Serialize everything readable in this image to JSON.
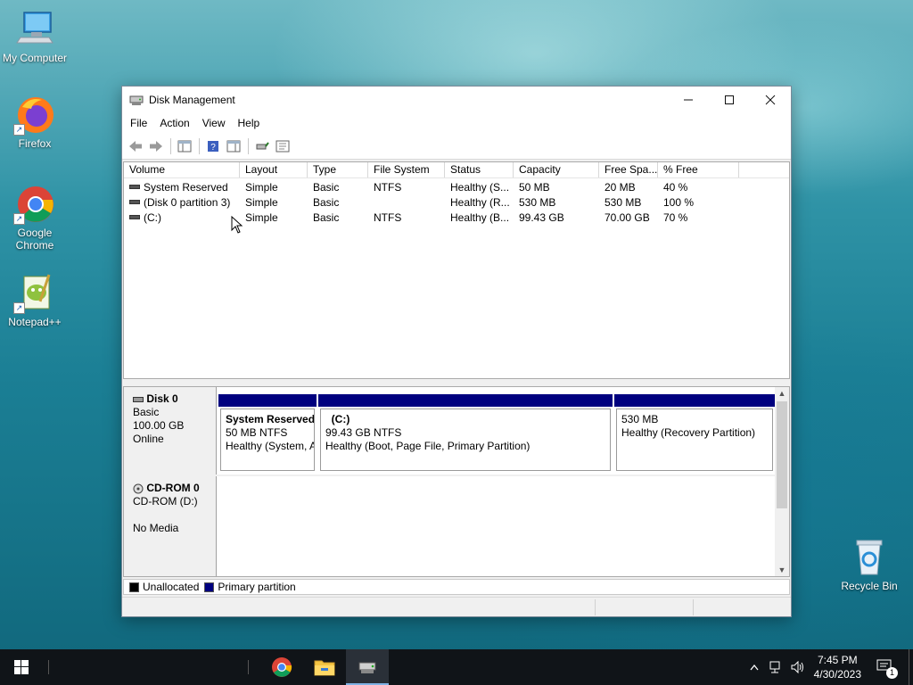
{
  "desktop": {
    "icons": [
      {
        "label": "My Computer"
      },
      {
        "label": "Firefox"
      },
      {
        "label": "Google Chrome"
      },
      {
        "label": "Notepad++"
      },
      {
        "label": "Recycle Bin"
      }
    ]
  },
  "window": {
    "title": "Disk Management",
    "menu": [
      "File",
      "Action",
      "View",
      "Help"
    ],
    "columns": [
      "Volume",
      "Layout",
      "Type",
      "File System",
      "Status",
      "Capacity",
      "Free Spa...",
      "% Free"
    ],
    "volumes": [
      {
        "volume": "System Reserved",
        "layout": "Simple",
        "type": "Basic",
        "fs": "NTFS",
        "status": "Healthy (S...",
        "capacity": "50 MB",
        "free": "20 MB",
        "pct": "40 %"
      },
      {
        "volume": "(Disk 0 partition 3)",
        "layout": "Simple",
        "type": "Basic",
        "fs": "",
        "status": "Healthy (R...",
        "capacity": "530 MB",
        "free": "530 MB",
        "pct": "100 %"
      },
      {
        "volume": "(C:)",
        "layout": "Simple",
        "type": "Basic",
        "fs": "NTFS",
        "status": "Healthy (B...",
        "capacity": "99.43 GB",
        "free": "70.00 GB",
        "pct": "70 %"
      }
    ],
    "disks": [
      {
        "name": "Disk 0",
        "lines": [
          "Basic",
          "100.00 GB",
          "Online"
        ],
        "partitions": [
          {
            "name": "System Reserved",
            "line1": "50 MB NTFS",
            "line2": "Healthy (System, A"
          },
          {
            "name": "(C:)",
            "line1": "99.43 GB NTFS",
            "line2": "Healthy (Boot, Page File, Primary Partition)"
          },
          {
            "name": "",
            "line1": "530 MB",
            "line2": "Healthy (Recovery Partition)"
          }
        ]
      },
      {
        "name": "CD-ROM 0",
        "lines": [
          "CD-ROM (D:)",
          "",
          "No Media"
        ]
      }
    ],
    "legend": [
      {
        "label": "Unallocated",
        "color": "#000000"
      },
      {
        "label": "Primary partition",
        "color": "#00007f"
      }
    ]
  },
  "taskbar": {
    "time": "7:45 PM",
    "date": "4/30/2023",
    "notification_count": "1"
  },
  "colors": {
    "primary_partition": "#00007f",
    "taskbar": "#101418"
  }
}
